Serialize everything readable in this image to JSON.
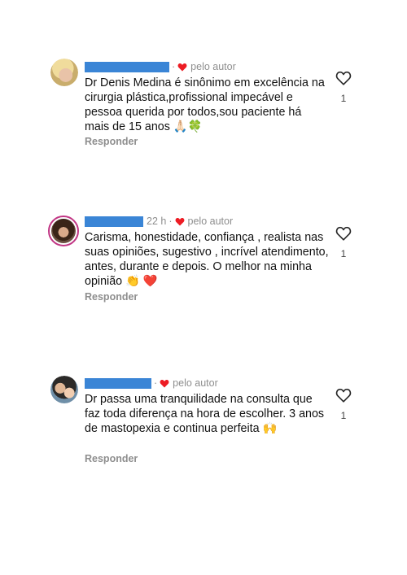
{
  "comments": [
    {
      "time": "",
      "author_badge": "pelo autor",
      "text": "Dr Denis Medina é sinônimo em excelência na cirurgia plástica,profissional impecável e pessoa querida por todos,sou paciente há mais de 15 anos 🙏🏻🍀",
      "reply_label": "Responder",
      "likes": "1",
      "avatar_icon": "avatar-blonde-woman",
      "has_story_ring": false
    },
    {
      "time": "22 h",
      "author_badge": "pelo autor",
      "text": "Carisma, honestidade, confiança , realista nas suas opiniões, sugestivo , incrível atendimento, antes, durante e depois.  O melhor na minha opinião 👏 ❤️",
      "reply_label": "Responder",
      "likes": "1",
      "avatar_icon": "avatar-dark-hair-woman",
      "has_story_ring": true
    },
    {
      "time": "",
      "author_badge": "pelo autor",
      "text": "Dr passa uma tranquilidade na consulta que faz toda diferença na hora de escolher. 3 anos de mastopexia e continua perfeita 🙌",
      "reply_label": "Responder",
      "likes": "1",
      "avatar_icon": "avatar-woman-with-child",
      "has_story_ring": false
    }
  ],
  "colors": {
    "author_heart": "#ed1c24",
    "redaction": "#3a85d6",
    "story_ring": "#c13584"
  }
}
